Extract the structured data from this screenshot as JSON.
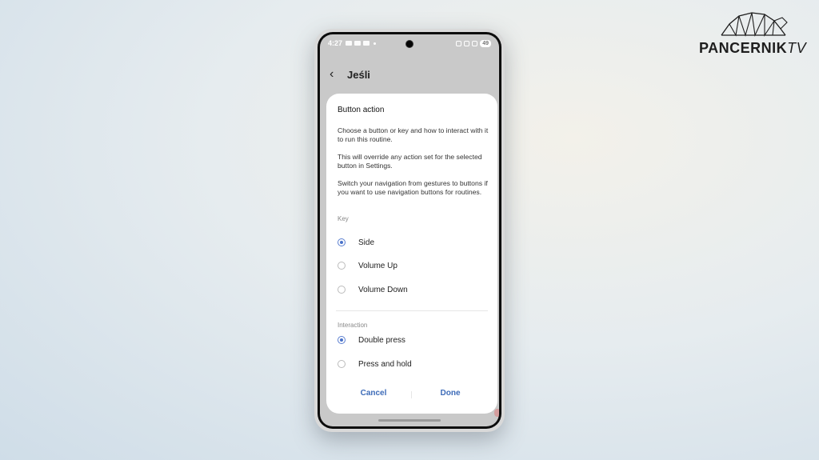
{
  "logo": {
    "brand": "PANCERNIK",
    "suffix": "TV"
  },
  "status_bar": {
    "time": "4:27",
    "battery": "49"
  },
  "app_bar": {
    "title": "Jeśli"
  },
  "dialog": {
    "title": "Button action",
    "paragraphs": [
      "Choose a button or key and how to interact with it to run this routine.",
      "This will override any action set for the selected button in Settings.",
      "Switch your navigation from gestures to buttons if you want to use navigation buttons for routines."
    ],
    "key_section": {
      "label": "Key",
      "options": [
        {
          "label": "Side",
          "selected": true
        },
        {
          "label": "Volume Up",
          "selected": false
        },
        {
          "label": "Volume Down",
          "selected": false
        }
      ]
    },
    "interaction_section": {
      "label": "Interaction",
      "options": [
        {
          "label": "Double press",
          "selected": true
        },
        {
          "label": "Press and hold",
          "selected": false
        }
      ]
    },
    "cancel_label": "Cancel",
    "done_label": "Done"
  },
  "colors": {
    "accent": "#3d6bb8",
    "radio_selected": "#4a72c9"
  }
}
